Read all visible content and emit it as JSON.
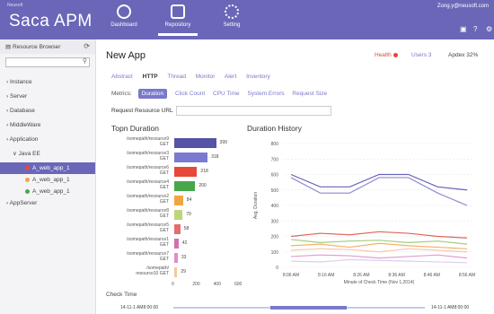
{
  "header": {
    "brand_small": "Neusoft",
    "brand": "Saca APM",
    "user": "Zong.y@neusoft.com",
    "nav": [
      {
        "label": "Dashboard"
      },
      {
        "label": "Repository"
      },
      {
        "label": "Setting"
      }
    ]
  },
  "sidebar": {
    "title": "Resource Browser",
    "items": [
      "Instance",
      "Server",
      "Database",
      "MiddleWare",
      "Application",
      "Java EE",
      "A_web_app_1",
      "A_web_app_1",
      "A_web_app_1",
      "AppServer"
    ]
  },
  "page": {
    "title": "New App",
    "health": "Health",
    "users": "Users 3",
    "apdex": "Apdex  32%"
  },
  "tabs": [
    "Abstract",
    "HTTP",
    "Thread",
    "Monitor",
    "Alert",
    "Inventory"
  ],
  "metrics": {
    "label": "Metrics:",
    "items": [
      "Duration",
      "Click Count",
      "CPU Time",
      "System Errors",
      "Request Size"
    ]
  },
  "request_url": {
    "label": "Request Resource URL",
    "value": ""
  },
  "topn": {
    "title": "Topn Duration",
    "items": [
      {
        "label1": "/somepath/resource9",
        "label2": "GET",
        "value": 399,
        "color": "#5553a6"
      },
      {
        "label1": "/somepath/resource3",
        "label2": "GET",
        "value": 318,
        "color": "#7b7ad0"
      },
      {
        "label1": "/somepath/resource6",
        "label2": "GET",
        "value": 218,
        "color": "#e8473a"
      },
      {
        "label1": "/somepath/resource4",
        "label2": "GET",
        "value": 200,
        "color": "#48a74b"
      },
      {
        "label1": "/somepath/resource2",
        "label2": "GET",
        "value": 84,
        "color": "#f0a640"
      },
      {
        "label1": "/somepath/resource8",
        "label2": "GET",
        "value": 79,
        "color": "#bcd67a"
      },
      {
        "label1": "/somepath/resource5",
        "label2": "GET",
        "value": 58,
        "color": "#e46d6d"
      },
      {
        "label1": "/somepath/resource1",
        "label2": "GET",
        "value": 42,
        "color": "#d36fb0"
      },
      {
        "label1": "/somepath/resource7",
        "label2": "GET",
        "value": 33,
        "color": "#e48cc5"
      },
      {
        "label1": "/somepath/",
        "label2": "resource10 GET",
        "value": 29,
        "color": "#f5c99a"
      }
    ],
    "ticks": [
      "0",
      "200",
      "400",
      "600"
    ]
  },
  "history": {
    "title": "Duration History",
    "ylabel": "Avg. Duration",
    "xlabel": "Minute of Check Time (Nov 1,2014)",
    "yticks": [
      "0",
      "100",
      "200",
      "300",
      "400",
      "500",
      "600",
      "700",
      "800"
    ],
    "xticks": [
      "8:06 AM",
      "8:16 AM",
      "8:26 AM",
      "8:36 AM",
      "8:46 AM",
      "8:56 AM"
    ]
  },
  "check_time": {
    "label": "Check Time",
    "start": "14-11-1 AM8:00:00",
    "end": "14-11-1 AM8:00:00"
  },
  "chart_data": [
    {
      "type": "bar",
      "title": "Topn Duration",
      "categories": [
        "/somepath/resource9 GET",
        "/somepath/resource3 GET",
        "/somepath/resource6 GET",
        "/somepath/resource4 GET",
        "/somepath/resource2 GET",
        "/somepath/resource8 GET",
        "/somepath/resource5 GET",
        "/somepath/resource1 GET",
        "/somepath/resource7 GET",
        "/somepath/resource10 GET"
      ],
      "values": [
        399,
        318,
        218,
        200,
        84,
        79,
        58,
        42,
        33,
        29
      ],
      "xlim": [
        0,
        600
      ]
    },
    {
      "type": "line",
      "title": "Duration History",
      "xlabel": "Minute of Check Time (Nov 1,2014)",
      "ylabel": "Avg. Duration",
      "ylim": [
        0,
        800
      ],
      "x": [
        "8:06 AM",
        "8:16 AM",
        "8:26 AM",
        "8:36 AM",
        "8:46 AM",
        "8:56 AM"
      ],
      "series": [
        {
          "color": "#6664b8",
          "values": [
            600,
            520,
            520,
            600,
            600,
            520,
            500
          ]
        },
        {
          "color": "#8e8ccf",
          "values": [
            580,
            480,
            480,
            580,
            580,
            480,
            400
          ]
        },
        {
          "color": "#e0665b",
          "values": [
            200,
            220,
            210,
            230,
            220,
            200,
            190
          ]
        },
        {
          "color": "#9ed07f",
          "values": [
            180,
            160,
            170,
            175,
            160,
            170,
            150
          ]
        },
        {
          "color": "#f3b16d",
          "values": [
            140,
            150,
            130,
            155,
            140,
            130,
            120
          ]
        },
        {
          "color": "#f7c6b0",
          "values": [
            110,
            120,
            115,
            100,
            120,
            110,
            100
          ]
        },
        {
          "color": "#e59ad3",
          "values": [
            70,
            80,
            75,
            60,
            70,
            80,
            60
          ]
        },
        {
          "color": "#d9d0f0",
          "values": [
            40,
            35,
            50,
            45,
            40,
            35,
            30
          ]
        }
      ]
    }
  ]
}
